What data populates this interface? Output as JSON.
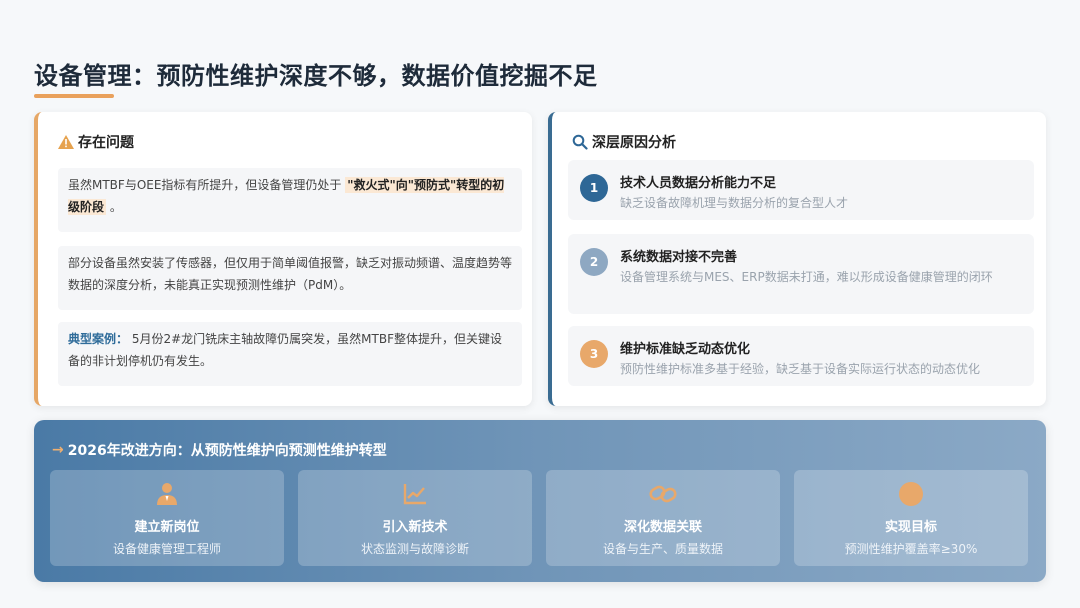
{
  "page": {
    "title": "设备管理：预防性维护深度不够，数据价值挖掘不足"
  },
  "problems": {
    "heading": "存在问题",
    "item1_pre": "虽然MTBF与OEE指标有所提升，但设备管理仍处于 ",
    "item1_highlight": "\"救火式\"向\"预防式\"转型的初级阶段",
    "item1_post": " 。",
    "item2": "部分设备虽然安装了传感器，但仅用于简单阈值报警，缺乏对振动频谱、温度趋势等数据的深度分析，未能真正实现预测性维护（PdM）。",
    "case_label": "典型案例：",
    "case_text": " 5月份2#龙门铣床主轴故障仍属突发，虽然MTBF整体提升，但关键设备的非计划停机仍有发生。"
  },
  "causes": {
    "heading": "深层原因分析",
    "items": [
      {
        "num": "1",
        "title": "技术人员数据分析能力不足",
        "desc": "缺乏设备故障机理与数据分析的复合型人才"
      },
      {
        "num": "2",
        "title": "系统数据对接不完善",
        "desc": "设备管理系统与MES、ERP数据未打通，难以形成设备健康管理的闭环"
      },
      {
        "num": "3",
        "title": "维护标准缺乏动态优化",
        "desc": "预防性维护标准多基于经验，缺乏基于设备实际运行状态的动态优化"
      }
    ]
  },
  "banner": {
    "title": "2026年改进方向：从预防性维护向预测性维护转型",
    "tiles": [
      {
        "label": "建立新岗位",
        "sub": "设备健康管理工程师",
        "icon": "user-icon"
      },
      {
        "label": "引入新技术",
        "sub": "状态监测与故障诊断",
        "icon": "chart-icon"
      },
      {
        "label": "深化数据关联",
        "sub": "设备与生产、质量数据",
        "icon": "link-icon"
      },
      {
        "label": "实现目标",
        "sub": "预测性维护覆盖率≥30%",
        "icon": "target-icon"
      }
    ]
  },
  "colors": {
    "accent_orange": "#e9a15c",
    "accent_blue": "#2e6796"
  }
}
